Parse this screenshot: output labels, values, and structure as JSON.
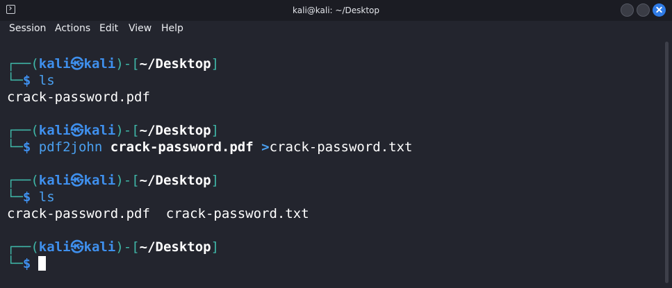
{
  "window": {
    "title": "kali@kali: ~/Desktop"
  },
  "menu": {
    "items": [
      "Session",
      "Actions",
      "Edit",
      "View",
      "Help"
    ]
  },
  "prompt": {
    "corner_top": "┌──(",
    "user": "kali",
    "separator": "㉿",
    "host": "kali",
    "mid": ")-[",
    "path": "~/Desktop",
    "close": "]",
    "corner_bottom": "└─",
    "symbol": "$"
  },
  "session": [
    {
      "command": "ls",
      "output": "crack-password.pdf"
    },
    {
      "command_program": "pdf2john",
      "command_arg": "crack-password.pdf",
      "command_redirect": ">",
      "command_target": "crack-password.txt"
    },
    {
      "command": "ls",
      "output": "crack-password.pdf  crack-password.txt"
    }
  ],
  "colors": {
    "background": "#23252e",
    "titlebar": "#1b1c23",
    "prompt_frame": "#3fb7a8",
    "prompt_user": "#3f90ee",
    "command": "#4aa0f0",
    "close_button": "#2f7be6"
  },
  "icons": {
    "app": "terminal-icon",
    "minimize": "minimize-button",
    "maximize": "maximize-button",
    "close": "close-icon"
  }
}
